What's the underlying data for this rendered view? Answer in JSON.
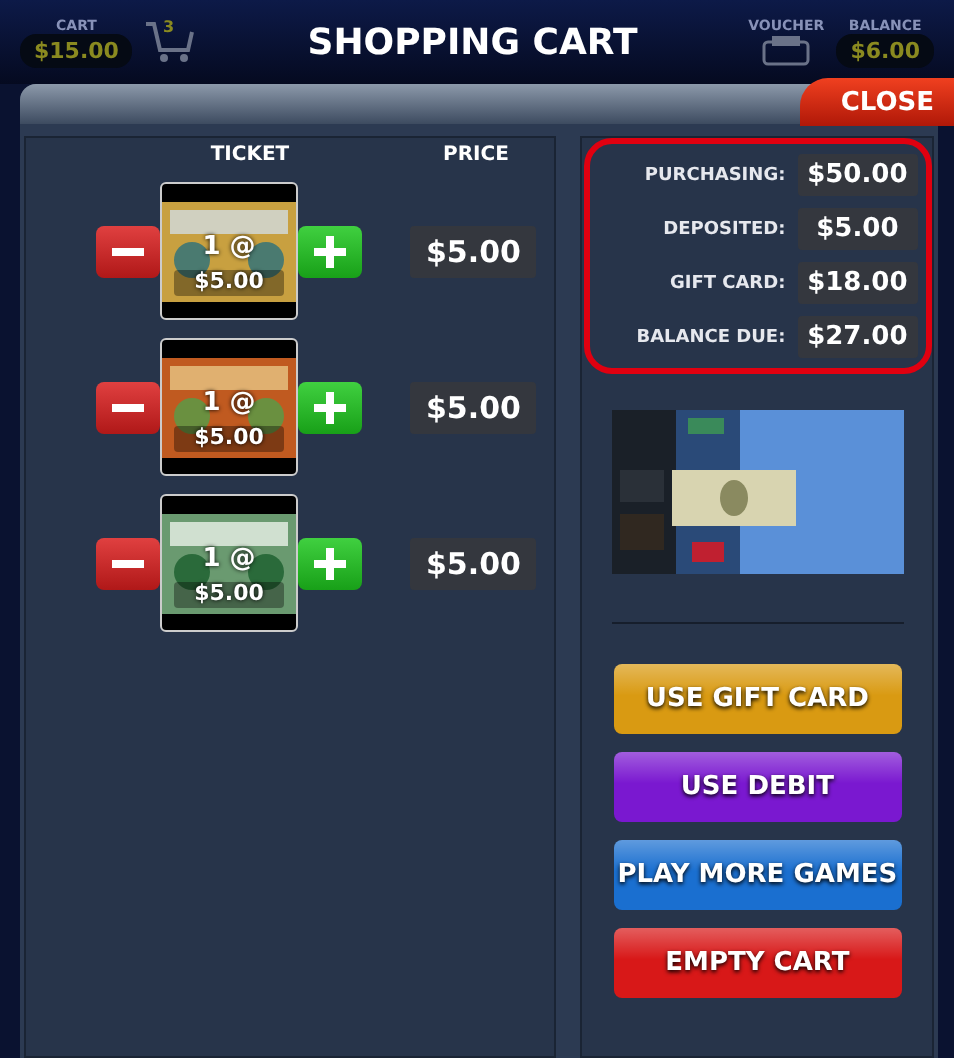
{
  "header": {
    "cart_label": "CART",
    "cart_amount": "$15.00",
    "cart_count": "3",
    "title": "SHOPPING CART",
    "voucher_label": "VOUCHER",
    "balance_label": "BALANCE",
    "balance_amount": "$6.00"
  },
  "close_button": "CLOSE",
  "columns": [
    "TICKET",
    "PRICE"
  ],
  "tickets": [
    {
      "kind": "picture",
      "quantity": "1 @",
      "unit_price": "$5.00",
      "price": "$5.00"
    },
    {
      "kind": "picture",
      "quantity": "1 @",
      "unit_price": "$5.00",
      "price": "$5.00"
    },
    {
      "kind": "picture",
      "quantity": "1 @",
      "unit_price": "$5.00",
      "price": "$5.00"
    }
  ],
  "summary": [
    {
      "label": "PURCHASING:",
      "value": "$50.00"
    },
    {
      "label": "DEPOSITED:",
      "value": "$5.00"
    },
    {
      "label": "GIFT CARD:",
      "value": "$18.00"
    },
    {
      "label": "BALANCE DUE:",
      "value": "$27.00"
    }
  ],
  "summary_highlighted": true,
  "actions": [
    {
      "label": "USE GIFT CARD",
      "color": "#d99a12"
    },
    {
      "label": "USE DEBIT",
      "color": "#7a18d0"
    },
    {
      "label": "PLAY MORE GAMES",
      "color": "#1a6fd0"
    },
    {
      "label": "EMPTY CART",
      "color": "#d81818"
    }
  ]
}
